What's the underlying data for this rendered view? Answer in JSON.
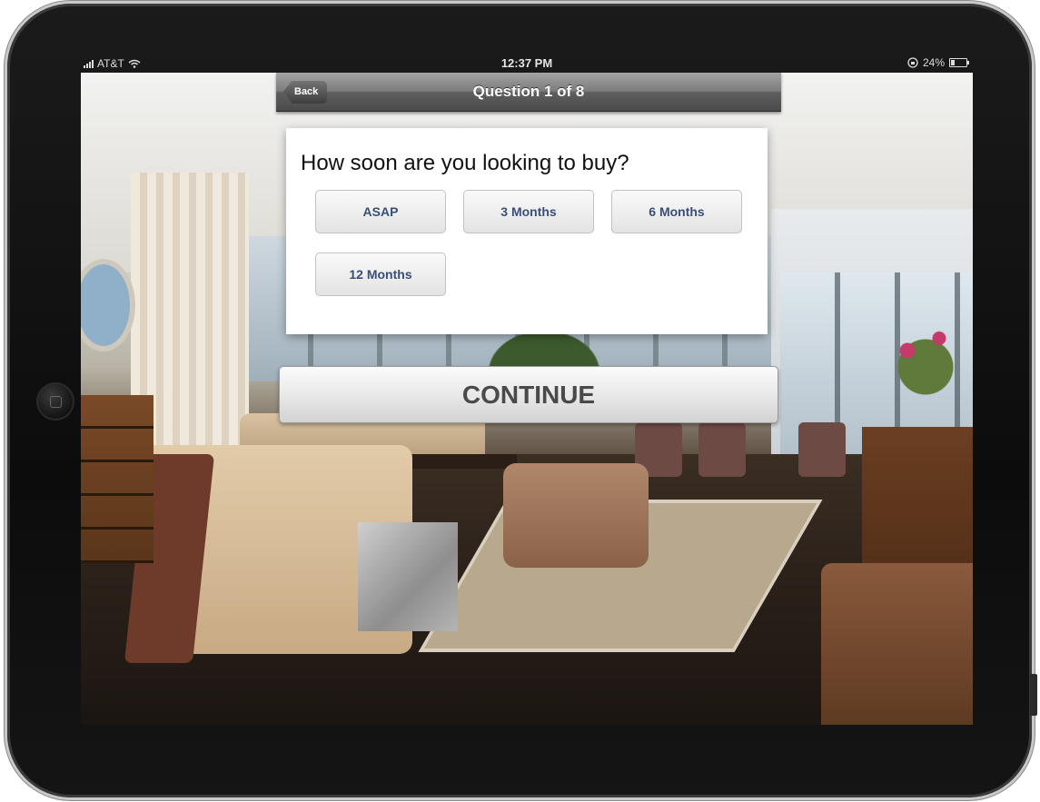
{
  "status_bar": {
    "carrier": "AT&T",
    "time": "12:37 PM",
    "battery_percent": "24%"
  },
  "nav": {
    "back_label": "Back",
    "title": "Question 1 of 8"
  },
  "question": {
    "text": "How soon are you looking to buy?",
    "options": [
      "ASAP",
      "3 Months",
      "6 Months",
      "12 Months"
    ]
  },
  "continue_label": "CONTINUE",
  "colors": {
    "option_text": "#3a4f78",
    "navbar": "#6a6a6a"
  }
}
